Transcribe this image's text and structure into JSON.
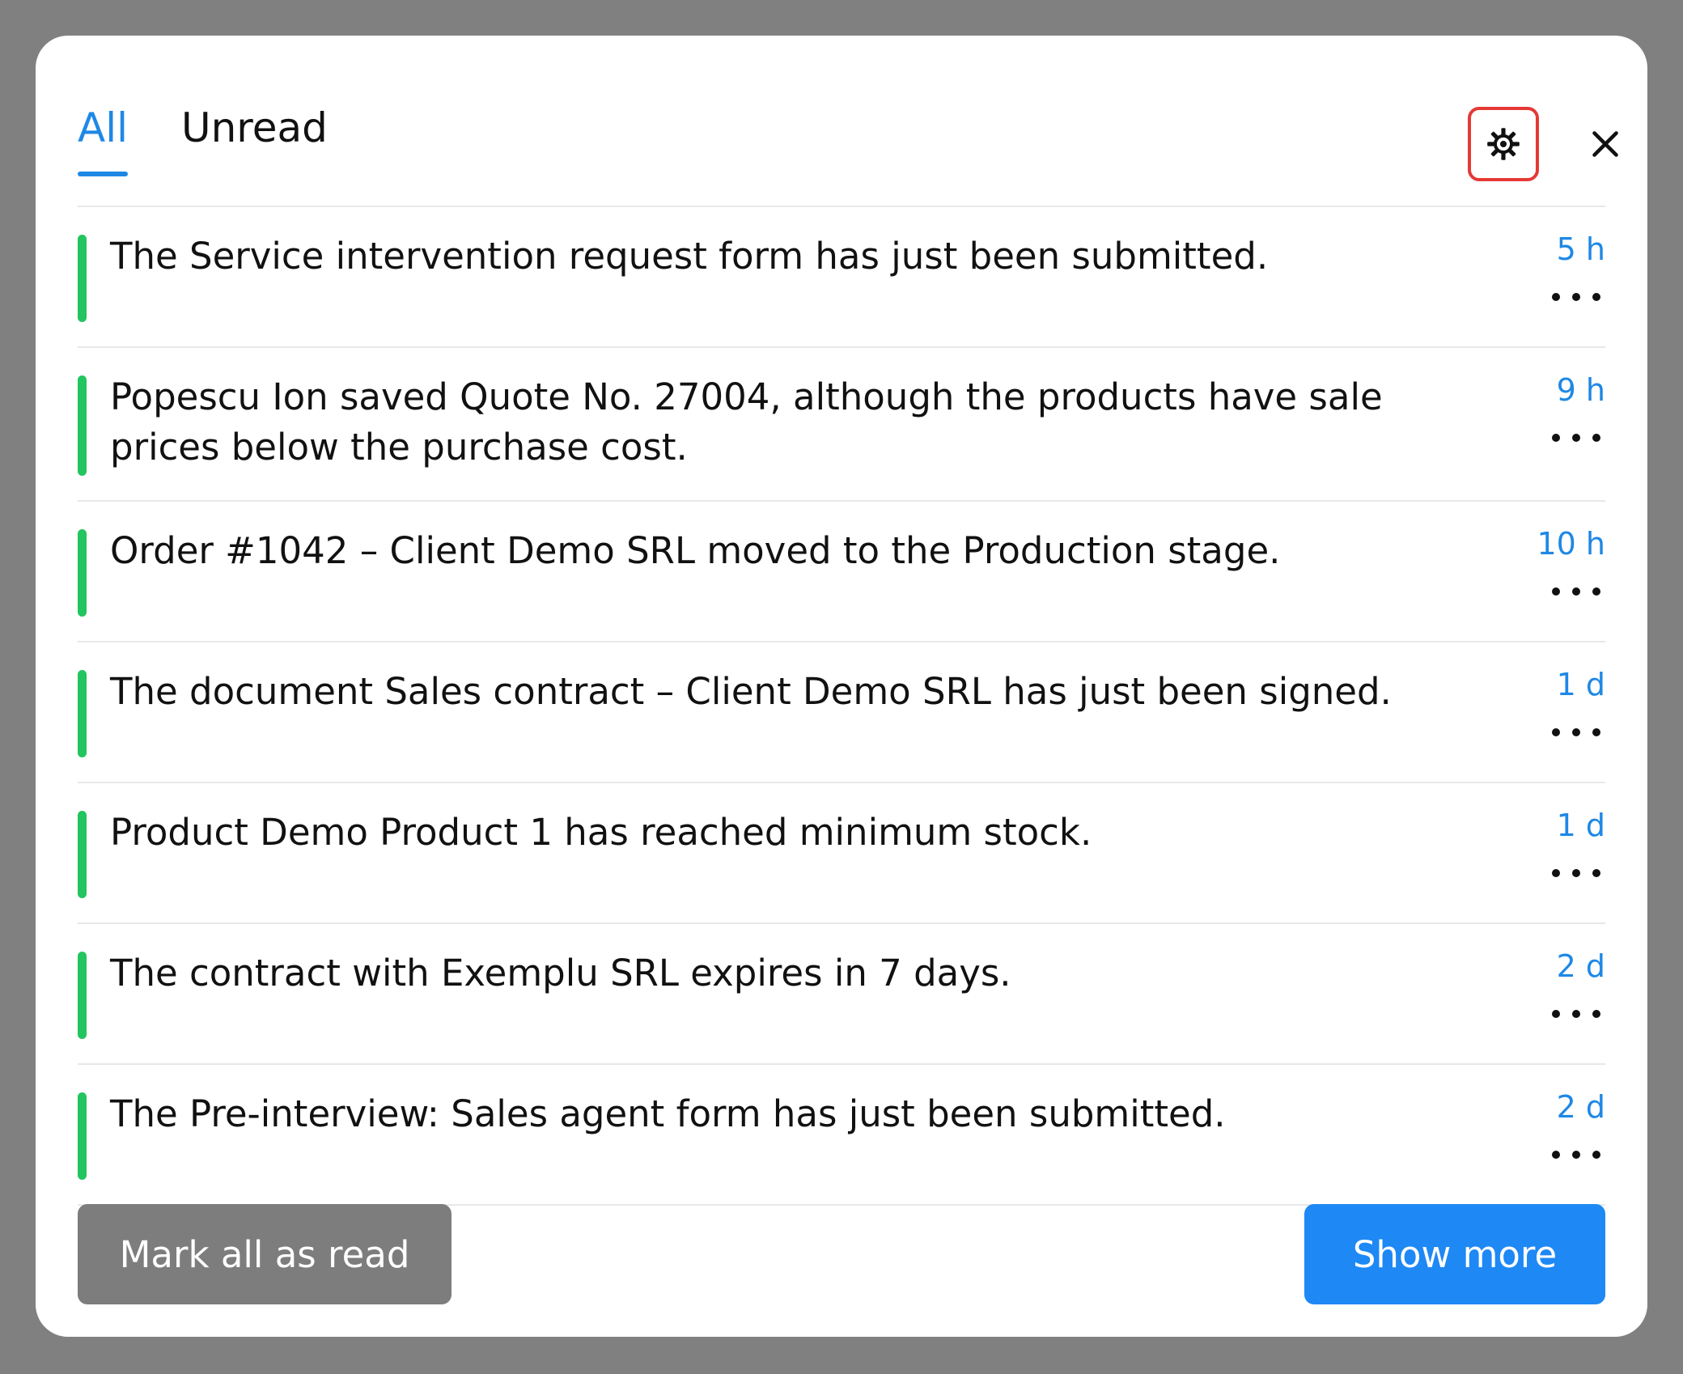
{
  "tabs": {
    "all": "All",
    "unread": "Unread"
  },
  "icons": {
    "settings": "gear-icon",
    "close": "close-icon",
    "more": "more-dots-icon"
  },
  "colors": {
    "accent": "#1e88e5",
    "unread_indicator": "#22c55e",
    "settings_highlight": "#e53935",
    "mark_all_button": "#7d7d7d",
    "show_more_button": "#1e88f5"
  },
  "notifications": [
    {
      "message": "The Service intervention request form has just been submitted.",
      "time": "5 h"
    },
    {
      "message": "Popescu Ion saved Quote No. 27004, although the products have sale prices below the purchase cost.",
      "time": "9 h"
    },
    {
      "message": "Order #1042 – Client Demo SRL moved to the Production stage.",
      "time": "10 h"
    },
    {
      "message": "The document Sales contract – Client Demo SRL has just been signed.",
      "time": "1 d"
    },
    {
      "message": "Product Demo Product 1 has reached minimum stock.",
      "time": "1 d"
    },
    {
      "message": "The contract with Exemplu SRL expires in 7 days.",
      "time": "2 d"
    },
    {
      "message": "The Pre-interview: Sales agent form has just been submitted.",
      "time": "2 d"
    }
  ],
  "footer": {
    "mark_all_read": "Mark all as read",
    "show_more": "Show more"
  }
}
